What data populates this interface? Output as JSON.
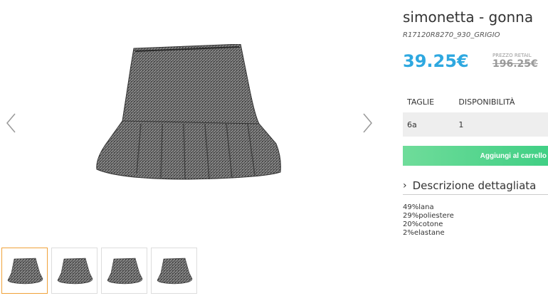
{
  "product": {
    "title": "simonetta - gonna",
    "sku": "R17120R8270_930_GRIGIO",
    "price": "39.25€",
    "retail_label": "PREZZO RETAIL",
    "retail_price": "196.25€"
  },
  "table": {
    "headers": [
      "TAGLIE",
      "DISPONIBILITÀ"
    ],
    "rows": [
      [
        "6a",
        "1"
      ]
    ]
  },
  "cart": {
    "add_label": "Aggiungi al carrello"
  },
  "description": {
    "title": "Descrizione dettagliata",
    "composition": [
      "49%lana",
      "29%poliestere",
      "20%cotone",
      "2%elastane"
    ]
  },
  "gallery": {
    "thumbnail_count": 4,
    "active_thumbnail": 0,
    "icons": {
      "prev": "chevron-left-icon",
      "next": "chevron-right-icon"
    }
  },
  "colors": {
    "price": "#2ea8e0",
    "button": "#3fcf84",
    "active_thumb": "#f0a23a"
  }
}
